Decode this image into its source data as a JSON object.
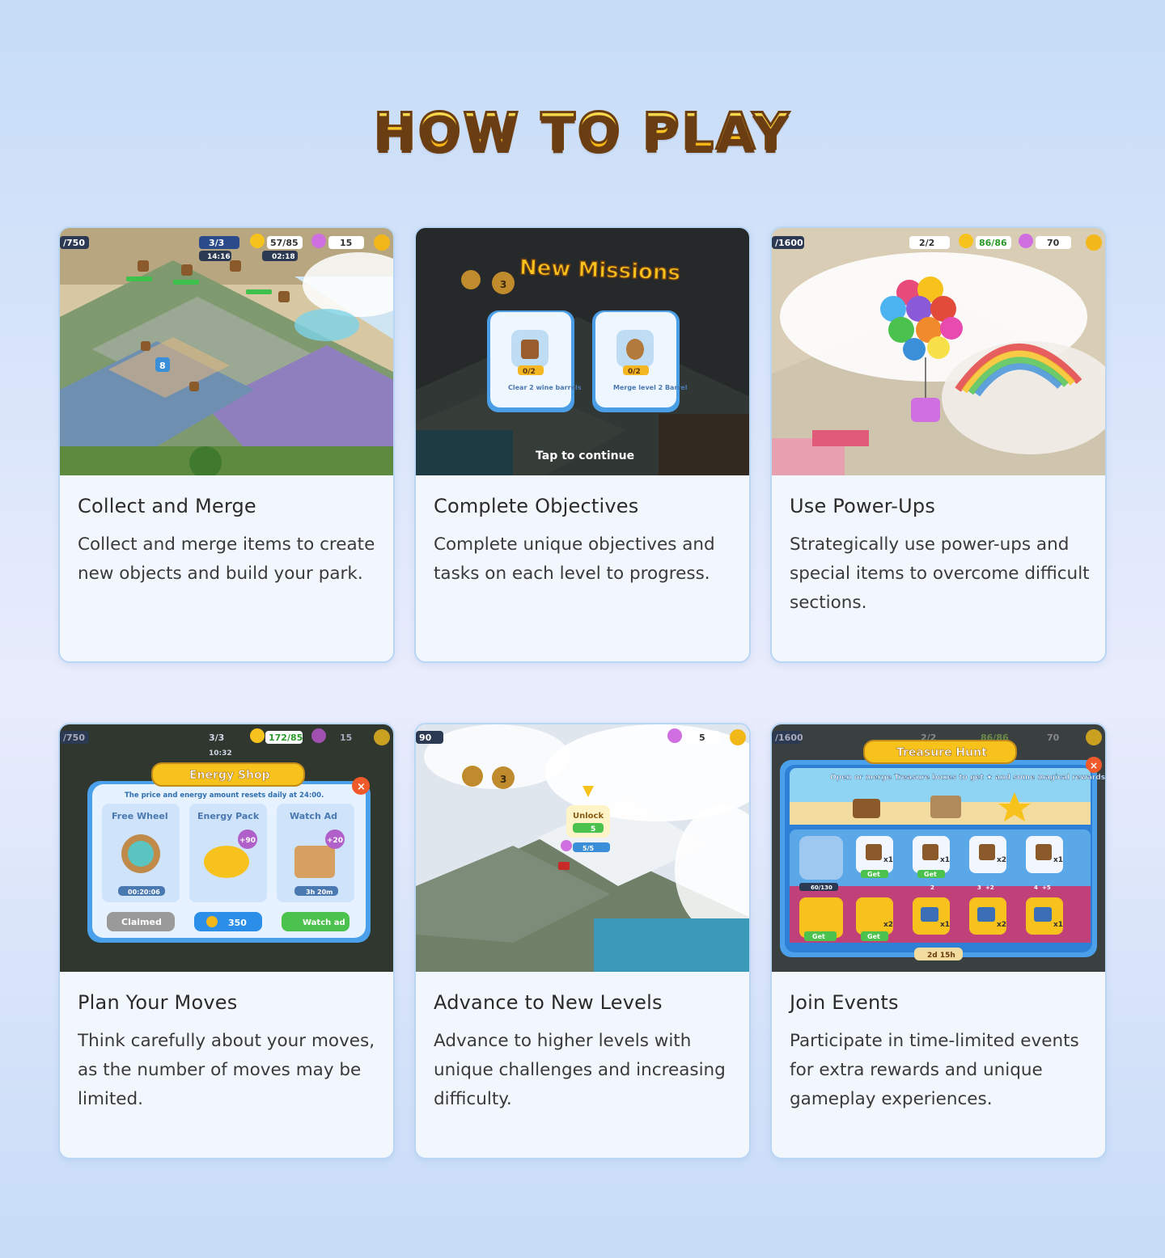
{
  "page_title": "How to Play",
  "cards": [
    {
      "title": "Collect and Merge",
      "description": "Collect and merge items to create new objects and build your park.",
      "screenshot": {
        "hud": {
          "left_counter": "/750",
          "moves": "3/3",
          "timer_1": "14:16",
          "energy": "57/85",
          "timer_2": "02:18",
          "gems": "15"
        },
        "tile_badge": "8"
      }
    },
    {
      "title": "Complete Objectives",
      "description": "Complete unique objectives and tasks on each level to progress.",
      "screenshot": {
        "heading": "New Missions",
        "lock_badge": "3",
        "missions": [
          {
            "progress": "0/2",
            "label": "Clear 2 wine barrels"
          },
          {
            "progress": "0/2",
            "label": "Merge level 2 Barrel"
          }
        ],
        "footer": "Tap to continue"
      }
    },
    {
      "title": "Use Power-Ups",
      "description": "Strategically use power-ups and special items to overcome difficult sections.",
      "screenshot": {
        "hud": {
          "left_counter": "/1600",
          "moves": "2/2",
          "energy": "86/86",
          "gems": "70"
        }
      }
    },
    {
      "title": "Plan Your Moves",
      "description": "Think carefully about your moves, as the number of moves may be limited.",
      "screenshot": {
        "hud": {
          "left_counter": "/750",
          "moves": "3/3",
          "timer_1": "10:32",
          "energy": "172/85",
          "gems": "15"
        },
        "panel_title": "Energy Shop",
        "notice": "The price and energy amount resets daily at 24:00.",
        "offers": [
          {
            "name": "Free Wheel",
            "timer": "00:20:06",
            "button": "Claimed"
          },
          {
            "name": "Energy Pack",
            "bonus": "+90",
            "button": "350"
          },
          {
            "name": "Watch Ad",
            "bonus": "+20",
            "timer": "3h 20m",
            "button": "Watch ad"
          }
        ]
      }
    },
    {
      "title": "Advance to New Levels",
      "description": "Advance to higher levels with unique challenges and increasing difficulty.",
      "screenshot": {
        "hud": {
          "left_counter": "90",
          "gems": "5"
        },
        "lock_badge": "3",
        "unlock_label": "Unlock",
        "unlock_cost": "5",
        "unlock_progress": "5/5"
      }
    },
    {
      "title": "Join Events",
      "description": "Participate in time-limited events for extra rewards and unique gameplay experiences.",
      "screenshot": {
        "hud": {
          "left_counter": "/1600",
          "moves": "2/2",
          "energy": "86/86",
          "gems": "70"
        },
        "panel_title": "Treasure Hunt",
        "banner_text": "Open or merge Treasure boxes to get ★ and some magical rewards!",
        "top_row": [
          "x1",
          "x1",
          "x2",
          "x1"
        ],
        "top_buttons": [
          "Get",
          "Get"
        ],
        "progress": "60/130",
        "tiers": [
          "2",
          "3",
          "4"
        ],
        "tier_bonus": [
          "+2",
          "+5"
        ],
        "bottom_row": [
          "x2",
          "x1",
          "x2",
          "x1"
        ],
        "bottom_buttons": [
          "Get",
          "Get"
        ],
        "timer": "2d 15h"
      }
    }
  ],
  "colors": {
    "title_fill": "#f7c21c",
    "title_outline": "#6b3d13",
    "card_bg": "#f2f7fd",
    "card_border": "#b9d6f5"
  }
}
